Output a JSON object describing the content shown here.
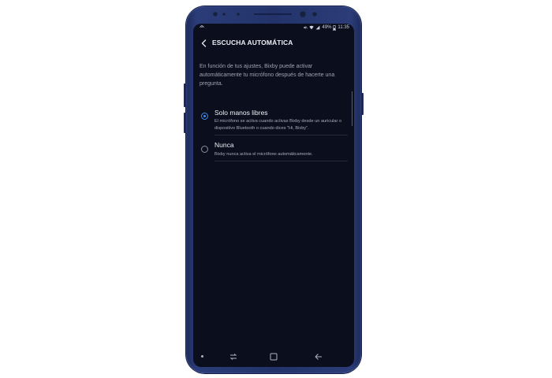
{
  "status_bar": {
    "battery": "49%",
    "time": "11:35",
    "icons": [
      "notification-icon",
      "mute-icon",
      "wifi-icon",
      "signal-icon",
      "battery-icon"
    ]
  },
  "app_bar": {
    "title": "ESCUCHA AUTOMÁTICA",
    "back_icon": "back-arrow-icon"
  },
  "description": "En función de tus ajustes, Bixby puede activar automáticamente tu micrófono después de hacerte una pregunta.",
  "options": [
    {
      "title": "Solo manos libres",
      "description": "El micrófono se activa cuando activas Bixby desde un auricular o dispositivo Bluetooth o cuando dices \"Hi, Bixby\".",
      "selected": true
    },
    {
      "title": "Nunca",
      "description": "Bixby nunca activa el micrófono automáticamente.",
      "selected": false
    }
  ],
  "nav_bar": {
    "icons": [
      "recent-apps-icon",
      "home-icon",
      "back-icon"
    ]
  },
  "colors": {
    "screen_background": "#0b0e1d",
    "accent": "#3d8ef0",
    "phone_body": "#23336a"
  }
}
